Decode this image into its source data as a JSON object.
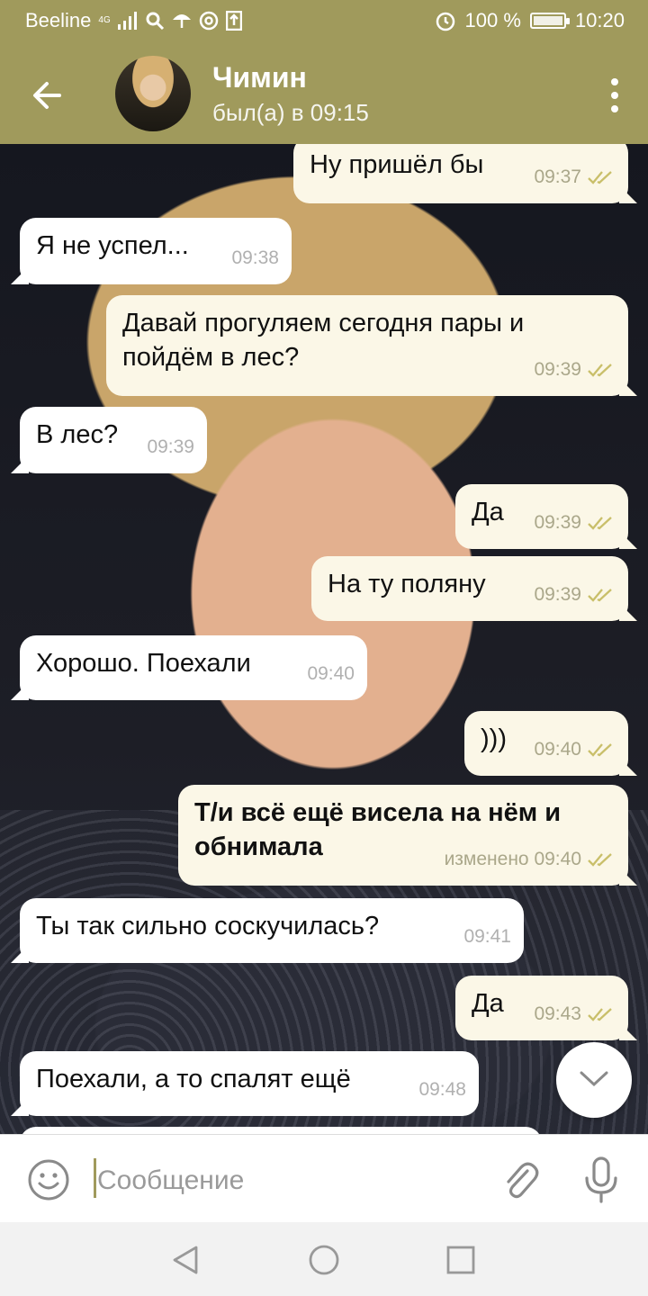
{
  "status_bar": {
    "carrier": "Beeline",
    "network": "4G",
    "battery": "100 %",
    "time": "10:20"
  },
  "header": {
    "contact_name": "Чимин",
    "last_seen": "был(а) в 09:15"
  },
  "messages": [
    {
      "dir": "out",
      "text": "Ну пришёл бы",
      "time": "09:37"
    },
    {
      "dir": "in",
      "text": "Я не успел...",
      "time": "09:38"
    },
    {
      "dir": "out",
      "text": "Давай прогуляем сегодня пары и\nпойдём в лес?",
      "time": "09:39"
    },
    {
      "dir": "in",
      "text": "В лес?",
      "time": "09:39"
    },
    {
      "dir": "out",
      "text": "Да",
      "time": "09:39"
    },
    {
      "dir": "out",
      "text": "На ту поляну",
      "time": "09:39"
    },
    {
      "dir": "in",
      "text": "Хорошо. Поехали",
      "time": "09:40"
    },
    {
      "dir": "out",
      "text": ")))",
      "time": "09:40"
    },
    {
      "dir": "out",
      "text": "Т/и всё ещё висела на нём и\nобнимала",
      "time": "изменено 09:40"
    },
    {
      "dir": "in",
      "text": "Ты так сильно соскучилась?",
      "time": "09:41"
    },
    {
      "dir": "out",
      "text": "Да",
      "time": "09:43"
    },
    {
      "dir": "in",
      "text": "Поехали, а то спалят ещё",
      "time": "09:48"
    }
  ],
  "composer": {
    "placeholder": "Сообщение"
  },
  "colors": {
    "header": "#a09a5c",
    "outgoing_bubble": "#fbf7e7",
    "incoming_bubble": "#ffffff",
    "read_ticks": "#c9bf6a"
  },
  "icons": [
    "back-arrow-icon",
    "more-vertical-icon",
    "double-check-icon",
    "chevron-down-icon",
    "emoji-icon",
    "paperclip-icon",
    "microphone-icon",
    "nav-back-icon",
    "nav-home-icon",
    "nav-recents-icon"
  ]
}
